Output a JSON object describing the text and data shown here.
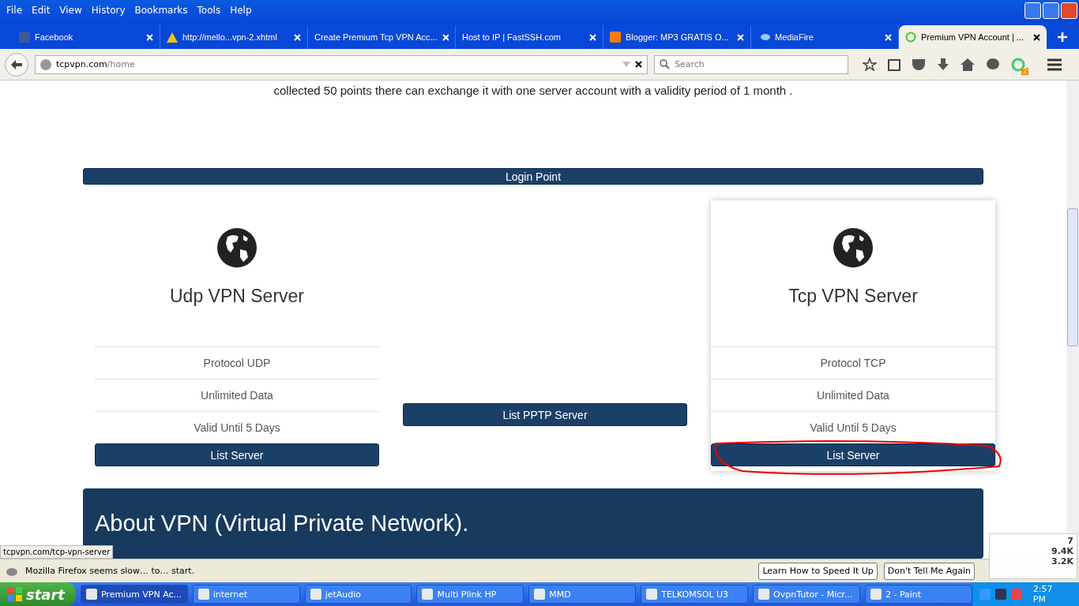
{
  "menu": [
    "File",
    "Edit",
    "View",
    "History",
    "Bookmarks",
    "Tools",
    "Help"
  ],
  "tabs": [
    {
      "label": "Facebook",
      "selected": false
    },
    {
      "label": "http://mello...vpn-2.xhtml",
      "selected": false
    },
    {
      "label": "Create Premium Tcp VPN Acc...",
      "selected": false
    },
    {
      "label": "Host to IP | FastSSH.com",
      "selected": false
    },
    {
      "label": "Blogger: MP3 GRATIS O...",
      "selected": false
    },
    {
      "label": "MediaFire",
      "selected": false
    },
    {
      "label": "Premium VPN Account | ...",
      "selected": true
    }
  ],
  "address": {
    "host": "tcpvpn.com",
    "path": "/home"
  },
  "search": {
    "placeholder": "Search"
  },
  "addon_badge": "2",
  "page": {
    "intro": "collected 50 points there can exchange it with one server account with a validity period of 1 month .",
    "login_bar": "Login Point",
    "columns": [
      {
        "kind": "card",
        "title": "Udp VPN Server",
        "features": [
          "Protocol UDP",
          "Unlimited Data",
          "Valid Until 5 Days"
        ],
        "button": "List Server",
        "raised": false,
        "highlighted": false
      },
      {
        "kind": "button",
        "button": "List PPTP Server"
      },
      {
        "kind": "card",
        "title": "Tcp VPN Server",
        "features": [
          "Protocol TCP",
          "Unlimited Data",
          "Valid Until 5 Days"
        ],
        "button": "List Server",
        "raised": true,
        "highlighted": true
      }
    ],
    "about_title": "About VPN (Virtual Private Network)."
  },
  "status_url": "tcpvpn.com/tcp-vpn-server",
  "notification": {
    "message": "Mozilla Firefox seems slow… to… start.",
    "buttons": [
      "Learn How to Speed It Up",
      "Don't Tell Me Again"
    ]
  },
  "meter": [
    "7",
    "9.4K",
    "3.2K"
  ],
  "taskbar": {
    "start": "start",
    "items": [
      {
        "label": "Premium VPN Ac...",
        "selected": true
      },
      {
        "label": "internet",
        "selected": false
      },
      {
        "label": "jetAudio",
        "selected": false
      },
      {
        "label": "Multi Plink HP",
        "selected": false
      },
      {
        "label": "MMD",
        "selected": false
      },
      {
        "label": "TELKOMSOL U3",
        "selected": false
      },
      {
        "label": "OvpnTutor - Micr...",
        "selected": false
      },
      {
        "label": "2 - Paint",
        "selected": false
      }
    ],
    "clock": "2:57 PM"
  }
}
